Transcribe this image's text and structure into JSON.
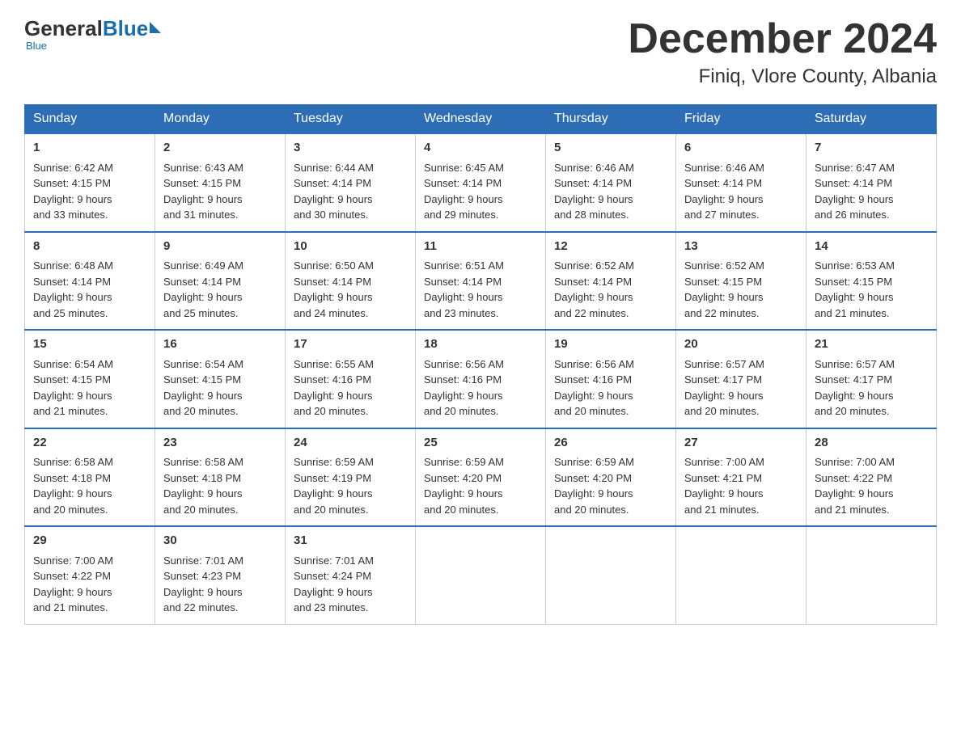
{
  "logo": {
    "general": "General",
    "blue": "Blue",
    "tagline": "Blue"
  },
  "title": "December 2024",
  "subtitle": "Finiq, Vlore County, Albania",
  "days_of_week": [
    "Sunday",
    "Monday",
    "Tuesday",
    "Wednesday",
    "Thursday",
    "Friday",
    "Saturday"
  ],
  "weeks": [
    [
      {
        "day": "1",
        "sunrise": "6:42 AM",
        "sunset": "4:15 PM",
        "daylight": "9 hours and 33 minutes."
      },
      {
        "day": "2",
        "sunrise": "6:43 AM",
        "sunset": "4:15 PM",
        "daylight": "9 hours and 31 minutes."
      },
      {
        "day": "3",
        "sunrise": "6:44 AM",
        "sunset": "4:14 PM",
        "daylight": "9 hours and 30 minutes."
      },
      {
        "day": "4",
        "sunrise": "6:45 AM",
        "sunset": "4:14 PM",
        "daylight": "9 hours and 29 minutes."
      },
      {
        "day": "5",
        "sunrise": "6:46 AM",
        "sunset": "4:14 PM",
        "daylight": "9 hours and 28 minutes."
      },
      {
        "day": "6",
        "sunrise": "6:46 AM",
        "sunset": "4:14 PM",
        "daylight": "9 hours and 27 minutes."
      },
      {
        "day": "7",
        "sunrise": "6:47 AM",
        "sunset": "4:14 PM",
        "daylight": "9 hours and 26 minutes."
      }
    ],
    [
      {
        "day": "8",
        "sunrise": "6:48 AM",
        "sunset": "4:14 PM",
        "daylight": "9 hours and 25 minutes."
      },
      {
        "day": "9",
        "sunrise": "6:49 AM",
        "sunset": "4:14 PM",
        "daylight": "9 hours and 25 minutes."
      },
      {
        "day": "10",
        "sunrise": "6:50 AM",
        "sunset": "4:14 PM",
        "daylight": "9 hours and 24 minutes."
      },
      {
        "day": "11",
        "sunrise": "6:51 AM",
        "sunset": "4:14 PM",
        "daylight": "9 hours and 23 minutes."
      },
      {
        "day": "12",
        "sunrise": "6:52 AM",
        "sunset": "4:14 PM",
        "daylight": "9 hours and 22 minutes."
      },
      {
        "day": "13",
        "sunrise": "6:52 AM",
        "sunset": "4:15 PM",
        "daylight": "9 hours and 22 minutes."
      },
      {
        "day": "14",
        "sunrise": "6:53 AM",
        "sunset": "4:15 PM",
        "daylight": "9 hours and 21 minutes."
      }
    ],
    [
      {
        "day": "15",
        "sunrise": "6:54 AM",
        "sunset": "4:15 PM",
        "daylight": "9 hours and 21 minutes."
      },
      {
        "day": "16",
        "sunrise": "6:54 AM",
        "sunset": "4:15 PM",
        "daylight": "9 hours and 20 minutes."
      },
      {
        "day": "17",
        "sunrise": "6:55 AM",
        "sunset": "4:16 PM",
        "daylight": "9 hours and 20 minutes."
      },
      {
        "day": "18",
        "sunrise": "6:56 AM",
        "sunset": "4:16 PM",
        "daylight": "9 hours and 20 minutes."
      },
      {
        "day": "19",
        "sunrise": "6:56 AM",
        "sunset": "4:16 PM",
        "daylight": "9 hours and 20 minutes."
      },
      {
        "day": "20",
        "sunrise": "6:57 AM",
        "sunset": "4:17 PM",
        "daylight": "9 hours and 20 minutes."
      },
      {
        "day": "21",
        "sunrise": "6:57 AM",
        "sunset": "4:17 PM",
        "daylight": "9 hours and 20 minutes."
      }
    ],
    [
      {
        "day": "22",
        "sunrise": "6:58 AM",
        "sunset": "4:18 PM",
        "daylight": "9 hours and 20 minutes."
      },
      {
        "day": "23",
        "sunrise": "6:58 AM",
        "sunset": "4:18 PM",
        "daylight": "9 hours and 20 minutes."
      },
      {
        "day": "24",
        "sunrise": "6:59 AM",
        "sunset": "4:19 PM",
        "daylight": "9 hours and 20 minutes."
      },
      {
        "day": "25",
        "sunrise": "6:59 AM",
        "sunset": "4:20 PM",
        "daylight": "9 hours and 20 minutes."
      },
      {
        "day": "26",
        "sunrise": "6:59 AM",
        "sunset": "4:20 PM",
        "daylight": "9 hours and 20 minutes."
      },
      {
        "day": "27",
        "sunrise": "7:00 AM",
        "sunset": "4:21 PM",
        "daylight": "9 hours and 21 minutes."
      },
      {
        "day": "28",
        "sunrise": "7:00 AM",
        "sunset": "4:22 PM",
        "daylight": "9 hours and 21 minutes."
      }
    ],
    [
      {
        "day": "29",
        "sunrise": "7:00 AM",
        "sunset": "4:22 PM",
        "daylight": "9 hours and 21 minutes."
      },
      {
        "day": "30",
        "sunrise": "7:01 AM",
        "sunset": "4:23 PM",
        "daylight": "9 hours and 22 minutes."
      },
      {
        "day": "31",
        "sunrise": "7:01 AM",
        "sunset": "4:24 PM",
        "daylight": "9 hours and 23 minutes."
      },
      null,
      null,
      null,
      null
    ]
  ],
  "labels": {
    "sunrise": "Sunrise:",
    "sunset": "Sunset:",
    "daylight": "Daylight:"
  }
}
